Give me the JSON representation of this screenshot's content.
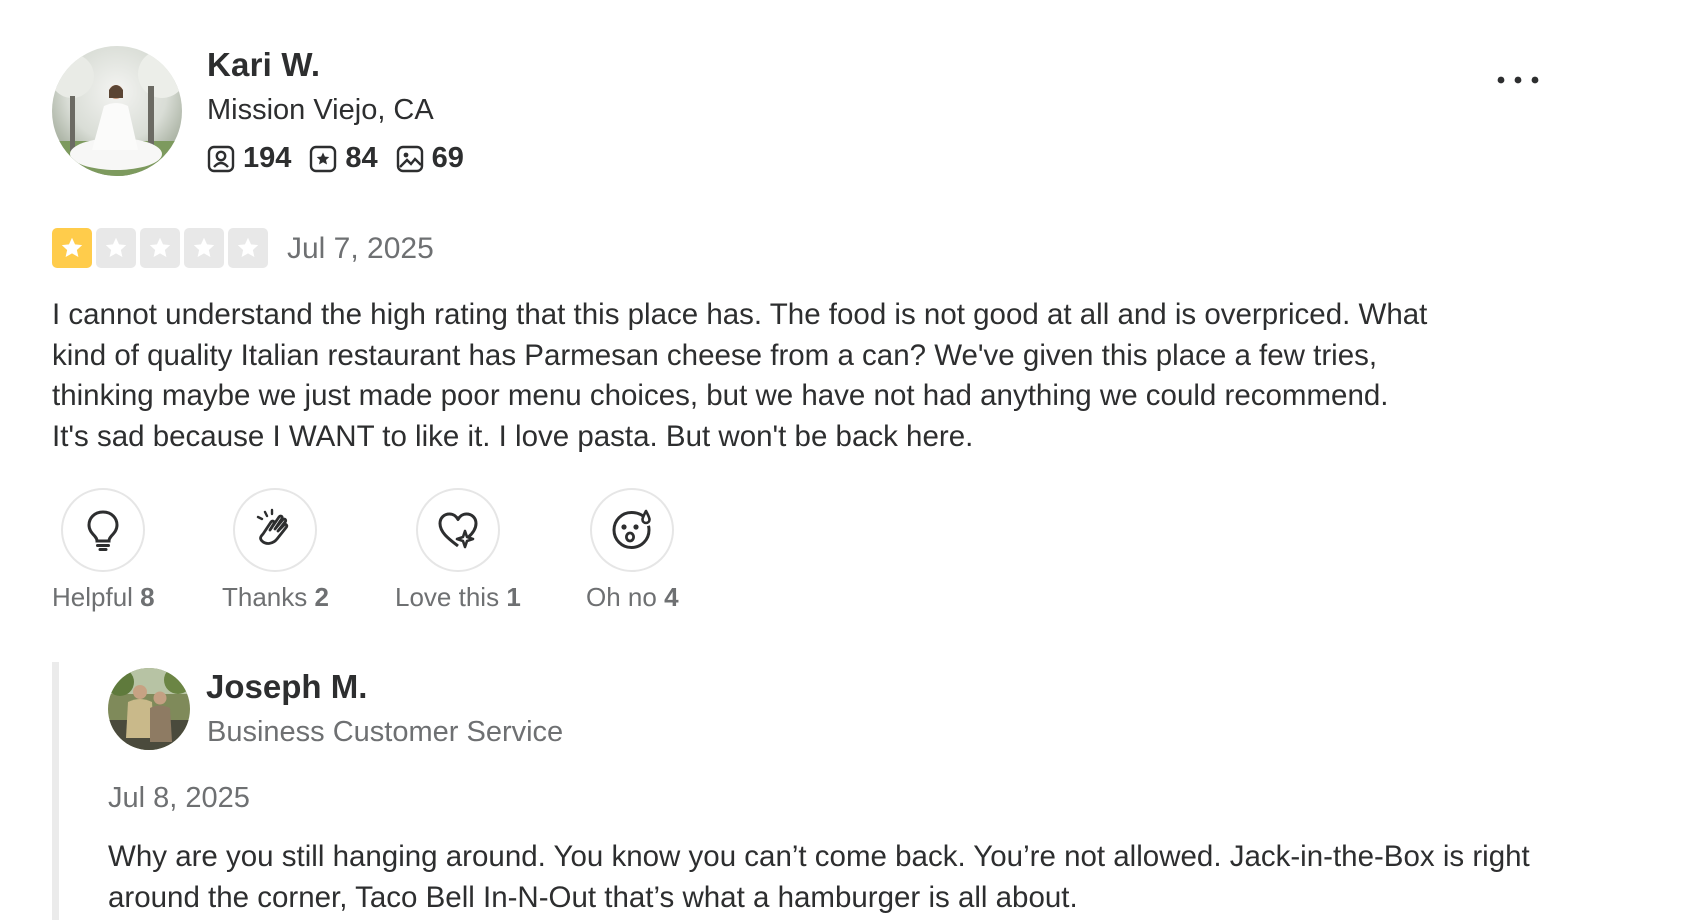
{
  "reviewer": {
    "name": "Kari W.",
    "location": "Mission Viejo, CA",
    "stats": {
      "friends": "194",
      "reviews": "84",
      "photos": "69"
    }
  },
  "review": {
    "rating": 1,
    "rating_max": 5,
    "date": "Jul 7, 2025",
    "text": "I cannot understand the high rating that this place has. The food is not good at all and is overpriced. What kind of quality Italian restaurant has Parmesan cheese from a can? We've given this place a few tries, thinking maybe we just made poor menu choices, but we have not had anything we could recommend. It's sad because I WANT to like it. I love pasta. But won't be back here."
  },
  "reactions": [
    {
      "label": "Helpful",
      "count": "8",
      "icon": "lightbulb-icon"
    },
    {
      "label": "Thanks",
      "count": "2",
      "icon": "clapping-hands-icon"
    },
    {
      "label": "Love this",
      "count": "1",
      "icon": "heart-sparkle-icon"
    },
    {
      "label": "Oh no",
      "count": "4",
      "icon": "sad-face-icon"
    }
  ],
  "owner_response": {
    "name": "Joseph M.",
    "role": "Business Customer Service",
    "date": "Jul 8, 2025",
    "text": "Why are you still hanging around. You know you can’t come back. You’re not allowed. Jack-in-the-Box is right around the corner, Taco Bell In-N-Out that’s what a hamburger is all about."
  },
  "colors": {
    "star_filled": "#ffcc4b",
    "star_empty": "#e8e8e8",
    "text_primary": "#2d2e2f",
    "text_secondary": "#6e7072"
  }
}
